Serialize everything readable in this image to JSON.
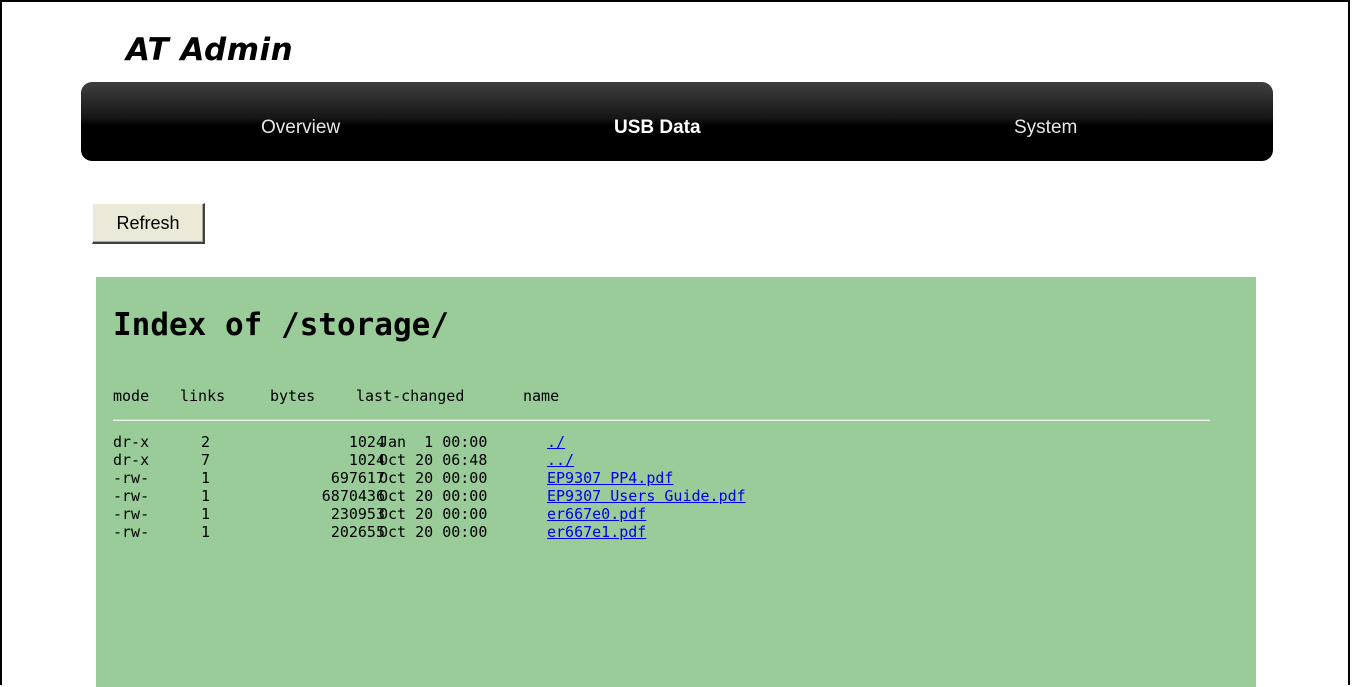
{
  "app": {
    "title": "AT Admin"
  },
  "nav": {
    "items": [
      {
        "label": "Overview",
        "active": false
      },
      {
        "label": "USB Data",
        "active": true
      },
      {
        "label": "System",
        "active": false
      }
    ]
  },
  "toolbar": {
    "refresh_label": "Refresh"
  },
  "listing": {
    "title": "Index of /storage/",
    "columns": [
      "mode",
      "links",
      "bytes",
      "last-changed",
      "name"
    ],
    "rows": [
      {
        "mode": "dr-x",
        "links": "2",
        "bytes": "1024",
        "last_changed": "Jan  1 00:00",
        "name": "./"
      },
      {
        "mode": "dr-x",
        "links": "7",
        "bytes": "1024",
        "last_changed": "Oct 20 06:48",
        "name": "../"
      },
      {
        "mode": "-rw-",
        "links": "1",
        "bytes": "697617",
        "last_changed": "Oct 20 00:00",
        "name": "EP9307 PP4.pdf"
      },
      {
        "mode": "-rw-",
        "links": "1",
        "bytes": "6870436",
        "last_changed": "Oct 20 00:00",
        "name": "EP9307 Users Guide.pdf"
      },
      {
        "mode": "-rw-",
        "links": "1",
        "bytes": "230953",
        "last_changed": "Oct 20 00:00",
        "name": "er667e0.pdf"
      },
      {
        "mode": "-rw-",
        "links": "1",
        "bytes": "202655",
        "last_changed": "Oct 20 00:00",
        "name": "er667e1.pdf"
      }
    ]
  },
  "colors": {
    "listing_background": "#99cc99",
    "link": "#0000ee",
    "navbar": "#000000"
  }
}
